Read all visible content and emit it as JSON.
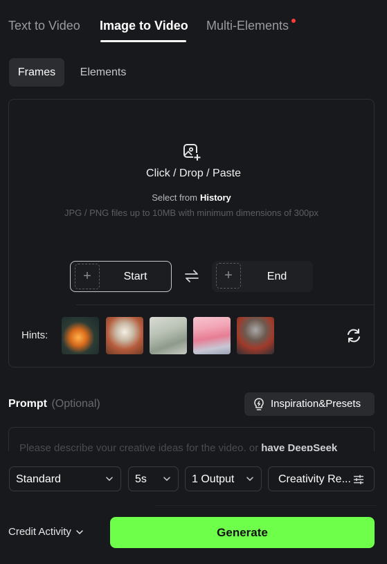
{
  "tabs": [
    {
      "label": "Text to Video"
    },
    {
      "label": "Image to Video",
      "active": true
    },
    {
      "label": "Multi-Elements",
      "has_notification": true
    }
  ],
  "subtabs": {
    "frames": "Frames",
    "elements": "Elements",
    "active": "Frames"
  },
  "upload": {
    "title": "Click / Drop / Paste",
    "select_prefix": "Select from",
    "history": "History",
    "file_hint": "JPG / PNG files up to 10MB with minimum dimensions of 300px"
  },
  "frames": {
    "start": "Start",
    "end": "End"
  },
  "hints": {
    "label": "Hints:"
  },
  "prompt": {
    "title": "Prompt",
    "optional": "(Optional)",
    "placeholder": "Please describe your creative ideas for the video, or",
    "deepseek_link": "have DeepSeek",
    "inspiration_button": "Inspiration&Presets"
  },
  "settings": {
    "mode": "Standard",
    "duration": "5s",
    "outputs": "1 Output",
    "creativity": "Creativity Re..."
  },
  "footer": {
    "credit": "Credit Activity",
    "generate": "Generate"
  },
  "colors": {
    "accent": "#6eff4a",
    "background": "#18191c",
    "notification": "#ff3b3b"
  }
}
